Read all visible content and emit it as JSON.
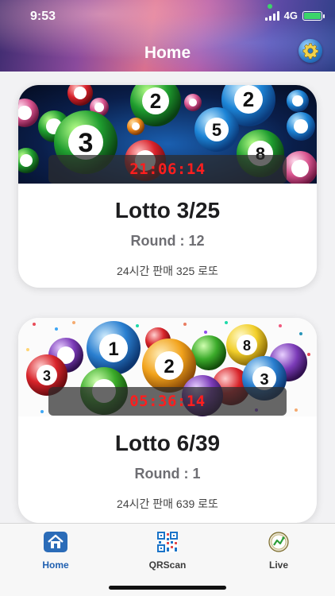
{
  "status_bar": {
    "time": "9:53",
    "network": "4G"
  },
  "header": {
    "title": "Home",
    "settings_icon": "gear-icon"
  },
  "cards": [
    {
      "timer": "21:06:14",
      "title": "Lotto 3/25",
      "round": "Round : 12",
      "description": "24시간 판매 325 로또"
    },
    {
      "timer": "05:36:14",
      "title": "Lotto 6/39",
      "round": "Round : 1",
      "description": "24시간 판매 639 로또"
    }
  ],
  "tabs": [
    {
      "label": "Home",
      "icon": "home-icon",
      "active": true
    },
    {
      "label": "QRScan",
      "icon": "qr-code-icon",
      "active": false
    },
    {
      "label": "Live",
      "icon": "live-icon",
      "active": false
    }
  ],
  "colors": {
    "timer_red": "#ff1e1e",
    "active_tab": "#1f5fb0"
  }
}
